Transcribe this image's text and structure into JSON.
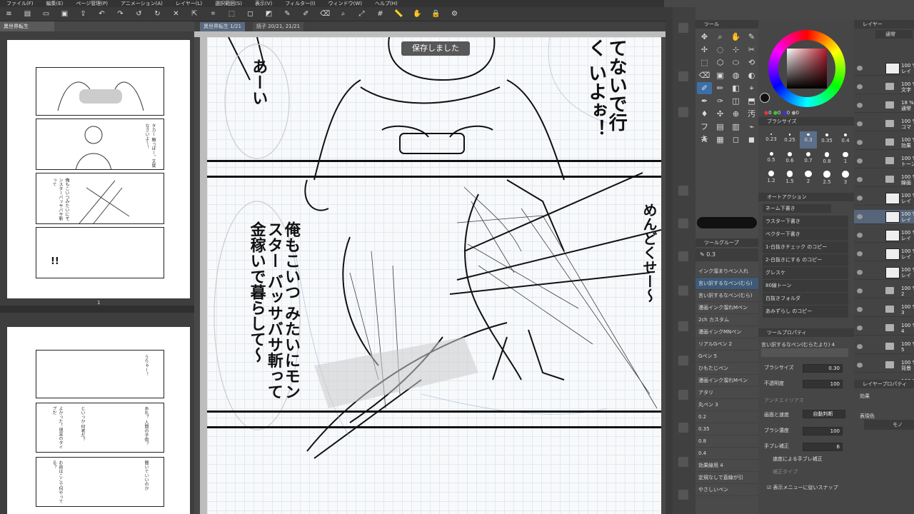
{
  "menu": [
    "ファイル(F)",
    "編集(E)",
    "ページ管理(P)",
    "アニメーション(A)",
    "レイヤー(L)",
    "選択範囲(S)",
    "表示(V)",
    "フィルター(I)",
    "ウィンドウ(W)",
    "ヘルプ(H)"
  ],
  "toolbar_icons": [
    "menu-icon",
    "new-file-icon",
    "open-icon",
    "save-icon",
    "export-icon",
    "undo-icon",
    "redo-icon",
    "rotate-left-icon",
    "rotate-right-icon",
    "clear-icon",
    "transform-icon",
    "crop-icon",
    "select-all-icon",
    "deselect-icon",
    "invert-icon",
    "pen-icon",
    "brush-icon",
    "eraser-icon",
    "zoom-icon",
    "fit-icon",
    "grid-icon",
    "ruler-icon",
    "hand-icon",
    "lock-icon",
    "settings-icon"
  ],
  "left_tab": "異世界転生",
  "doc_tabs": {
    "active": "異世界転生 1/21",
    "other": "読子 20/21, 21/21"
  },
  "toast": "保存しました",
  "nav": {
    "page_number": "1"
  },
  "thumb_texts": [
    "タカー 頼っぽー。文度なさいよ〜！",
    "うりゃー！",
    "俺もこいつみたいにモンスターバッサバサ斬って",
    "!!",
    "あれ？ 人間の子供？",
    "といっか 何者だ？",
    "よかった！現実のタイプだ",
    "お前はここで何やってる？",
    "聞いていいのか"
  ],
  "manga_text": {
    "top_right": "てないで行く いよぉ！",
    "top_left": "あーい",
    "middle_left": "俺もこいつ みたいにモンスター バッサバサ斬って 金稼いで暮らして〜",
    "right": "めんどくせー〜"
  },
  "tool_panel": {
    "header": "ツール",
    "tools": [
      "✥",
      "⌕",
      "✋",
      "✎",
      "✢",
      "◌",
      "⊹",
      "✂",
      "⬚",
      "⬡",
      "⬭",
      "⟲",
      "⌫",
      "▣",
      "◍",
      "◐",
      "✐",
      "✏",
      "◧",
      "⌖",
      "✒",
      "✑",
      "◫",
      "⬒",
      "♦",
      "✣",
      "⊕",
      "汚",
      "フキ",
      "▤",
      "▥",
      "⌁",
      "A",
      "▦",
      "◻",
      "◼"
    ],
    "sub_header": "ツールグループ",
    "sub_value": "0.3",
    "sub_items": [
      "インク溜まりペン入れ",
      "言い訳するなペン(むら)",
      "言い訳するなペン(むら)",
      "漫画インク溜れMペン",
      "2ch カスタム",
      "漫画インクMNペン",
      "リアルGペン 2",
      "Gペン 5",
      "ひもたじペン",
      "漫画インク溜れMペン",
      "アタリ",
      "丸ペン 3",
      "0.2",
      "0.35",
      "0.8",
      "0.4",
      "効果線用 4",
      "定規なしで直線が引",
      "やさしいペン"
    ]
  },
  "color": {
    "main": "#b51a2a",
    "sub": "#ffffff",
    "values": [
      "0",
      "0",
      "0",
      "0"
    ]
  },
  "brush_size": {
    "header": "ブラシサイズ",
    "sizes": [
      "0.23",
      "0.25",
      "0.3",
      "0.35",
      "0.4",
      "0.5",
      "0.6",
      "0.7",
      "0.8",
      "1",
      "1.2",
      "1.5",
      "2",
      "2.5",
      "3"
    ],
    "selected": "0.3"
  },
  "auto_action": {
    "header": "オートアクション",
    "set": "ネーム下書き",
    "items": [
      "ラスター下書き",
      "ベクター下書き",
      "1-白抜きチェック のコピー",
      "2-白抜きにする のコピー",
      "グレスケ",
      "80線トーン",
      "白抜きフォルダ",
      "あみずらし のコピー"
    ]
  },
  "tool_prop": {
    "header": "ツールプロパティ",
    "brush_name": "言い訳するなペン(むらたより) 4",
    "size_label": "ブラシサイズ",
    "size_value": "0.30",
    "opacity_label": "不透明度",
    "opacity_value": "100",
    "aa_label": "アンチエイリアス",
    "speed_label": "画面と速度",
    "speed_value": "自動判断",
    "density_label": "ブラシ濃度",
    "density_value": "100",
    "stab_label": "手ブレ補正",
    "stab_value": "6",
    "speed_stab": "速度による手ブレ補正",
    "type_label": "補正タイプ",
    "snap": "表示メニューに従いスナップ"
  },
  "layers": {
    "header": "レイヤー",
    "blend": "通常",
    "items": [
      {
        "pct": "100 %",
        "name": "レイ"
      },
      {
        "pct": "100 %",
        "name": "文字"
      },
      {
        "pct": "18 %",
        "name": "通常"
      },
      {
        "pct": "100 %",
        "name": "コマ"
      },
      {
        "pct": "100 %",
        "name": "効果"
      },
      {
        "pct": "100 %",
        "name": "トーン"
      },
      {
        "pct": "100 %",
        "name": "線画"
      },
      {
        "pct": "100 %",
        "name": "レイ"
      },
      {
        "pct": "100 %",
        "name": "レイ"
      },
      {
        "pct": "100 %",
        "name": "レイ"
      },
      {
        "pct": "100 %",
        "name": "レイ"
      },
      {
        "pct": "100 %",
        "name": "レイ"
      },
      {
        "pct": "100 %",
        "name": "2"
      },
      {
        "pct": "100 %",
        "name": "3"
      },
      {
        "pct": "100 %",
        "name": "4"
      },
      {
        "pct": "100 %",
        "name": "5"
      },
      {
        "pct": "100 %",
        "name": "背景"
      },
      {
        "pct": "100 %",
        "name": "フォル"
      }
    ]
  },
  "layer_prop": {
    "header": "レイヤープロパティ",
    "effect": "効果",
    "color_label": "表現色",
    "color_value": "モノ"
  }
}
